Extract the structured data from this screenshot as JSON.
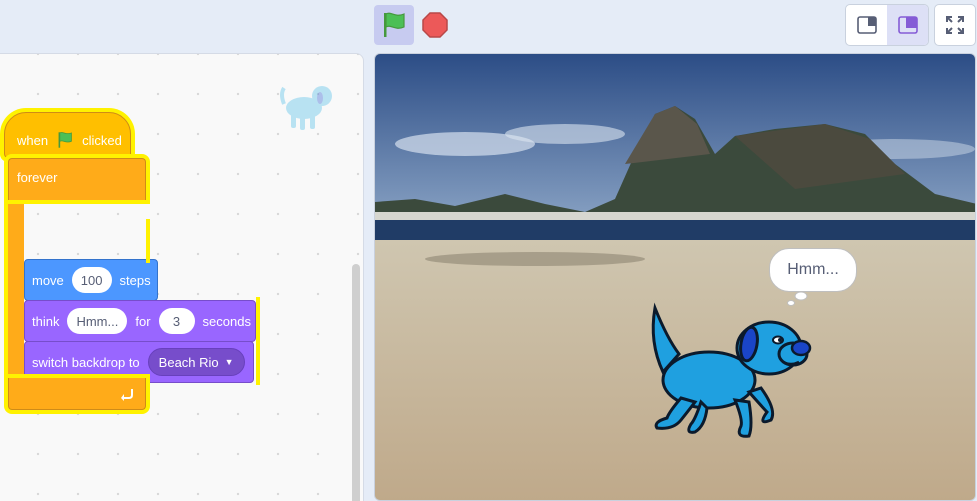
{
  "controls": {
    "green_flag": "green-flag-icon",
    "stop": "stop-sign-icon",
    "layout_small": "small-stage-icon",
    "layout_normal": "normal-stage-icon",
    "fullscreen": "fullscreen-icon"
  },
  "script": {
    "hat": {
      "word1": "when",
      "word2": "clicked"
    },
    "forever": {
      "label": "forever"
    },
    "move": {
      "label": "move",
      "value": "100",
      "unit": "steps"
    },
    "think": {
      "label": "think",
      "message": "Hmm...",
      "for": "for",
      "seconds_value": "3",
      "seconds": "seconds"
    },
    "switch": {
      "label": "switch backdrop to",
      "backdrop": "Beach Rio"
    }
  },
  "stage": {
    "speech": "Hmm...",
    "backdrop": "Beach Rio"
  },
  "colors": {
    "events": "#ffbf00",
    "control": "#ffab19",
    "motion": "#4c97ff",
    "looks": "#9966ff",
    "glow": "#fff200"
  }
}
